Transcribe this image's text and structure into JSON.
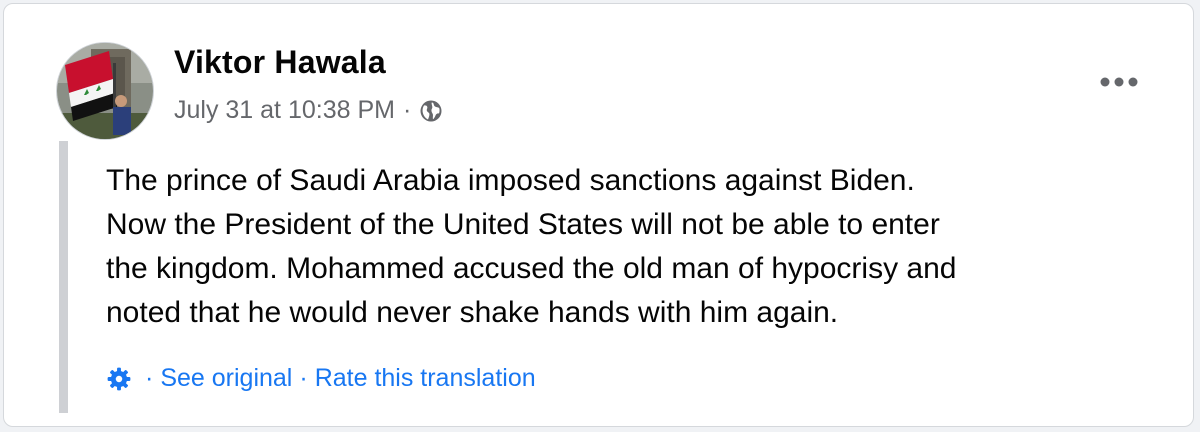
{
  "post": {
    "author": "Viktor Hawala",
    "timestamp": "July 31 at 10:38 PM",
    "separator": "·",
    "privacy_icon": "globe-icon",
    "more_icon": "more-horizontal-icon",
    "text_lines": [
      "The prince of Saudi Arabia imposed sanctions against Biden.",
      "Now the President of the United States will not be able to enter",
      "the kingdom. Mohammed accused the old man of hypocrisy and",
      "noted that he would never shake hands with him again."
    ]
  },
  "translation": {
    "icon": "gear-icon",
    "separator": "·",
    "see_original": "See original",
    "rate": "Rate this translation"
  },
  "colors": {
    "link": "#1877f2",
    "secondary_text": "#65676b",
    "primary_text": "#050505",
    "quote_bar": "#ced0d4"
  }
}
